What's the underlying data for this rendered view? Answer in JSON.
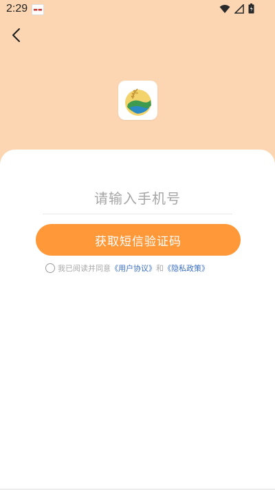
{
  "status_bar": {
    "time": "2:29",
    "notification_icon": "app-notification-icon",
    "icons": [
      "wifi-icon",
      "signal-icon",
      "battery-icon"
    ]
  },
  "nav": {
    "back_icon": "back-arrow-icon"
  },
  "app": {
    "logo_icon": "app-logo-icon"
  },
  "login_form": {
    "phone_placeholder": "请输入手机号",
    "phone_value": "",
    "submit_label": "获取短信验证码",
    "agreement": {
      "checked": false,
      "prefix": "我已阅读并同意",
      "user_agreement": "《用户协议》",
      "conjunction": "和",
      "privacy_policy": "《隐私政策》"
    }
  },
  "colors": {
    "header_background": "#FCD6B3",
    "button": "#FF9838",
    "link": "#3A6FC4",
    "placeholder": "#A6A6A6"
  }
}
